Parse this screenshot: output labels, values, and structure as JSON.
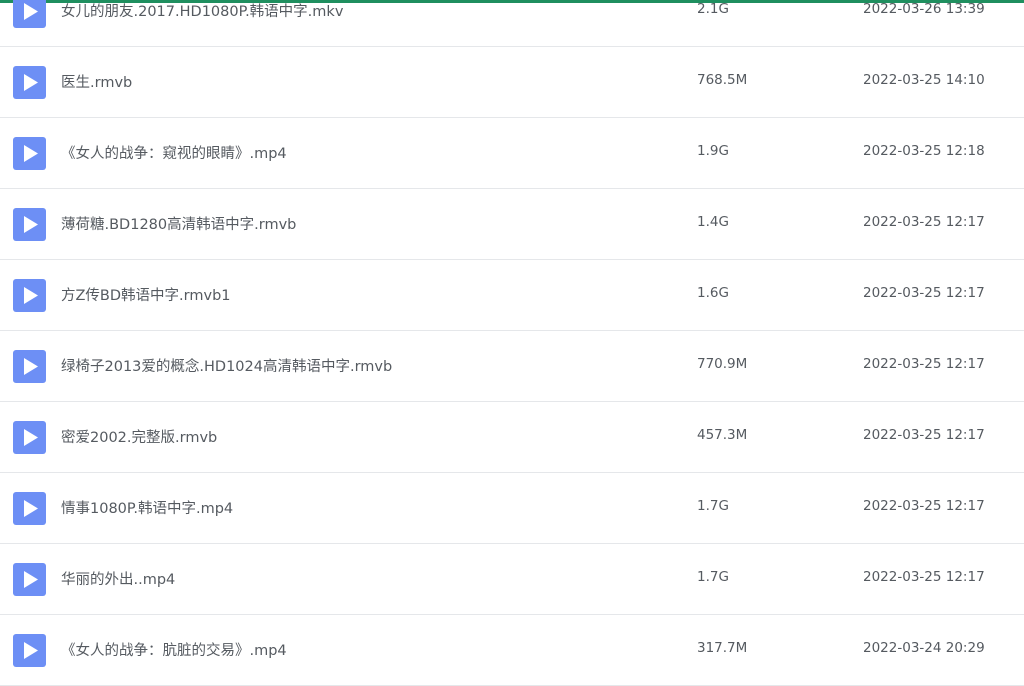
{
  "colors": {
    "accent": "#1f8f5f",
    "play_icon_bg": "#6d8ff5",
    "text": "#555a60",
    "divider": "#e5e7ea"
  },
  "files": [
    {
      "icon": "video-play-icon",
      "name": "女儿的朋友.2017.HD1080P.韩语中字.mkv",
      "size": "2.1G",
      "date": "2022-03-26 13:39"
    },
    {
      "icon": "video-play-icon",
      "name": "医生.rmvb",
      "size": "768.5M",
      "date": "2022-03-25 14:10"
    },
    {
      "icon": "video-play-icon",
      "name": "《女人的战争：窥视的眼睛》.mp4",
      "size": "1.9G",
      "date": "2022-03-25 12:18"
    },
    {
      "icon": "video-play-icon",
      "name": "薄荷糖.BD1280高清韩语中字.rmvb",
      "size": "1.4G",
      "date": "2022-03-25 12:17"
    },
    {
      "icon": "video-play-icon",
      "name": "方Z传BD韩语中字.rmvb1",
      "size": "1.6G",
      "date": "2022-03-25 12:17"
    },
    {
      "icon": "video-play-icon",
      "name": "绿椅子2013爱的概念.HD1024高清韩语中字.rmvb",
      "size": "770.9M",
      "date": "2022-03-25 12:17"
    },
    {
      "icon": "video-play-icon",
      "name": "密爱2002.完整版.rmvb",
      "size": "457.3M",
      "date": "2022-03-25 12:17"
    },
    {
      "icon": "video-play-icon",
      "name": "情事1080P.韩语中字.mp4",
      "size": "1.7G",
      "date": "2022-03-25 12:17"
    },
    {
      "icon": "video-play-icon",
      "name": "华丽的外出..mp4",
      "size": "1.7G",
      "date": "2022-03-25 12:17"
    },
    {
      "icon": "video-play-icon",
      "name": "《女人的战争：肮脏的交易》.mp4",
      "size": "317.7M",
      "date": "2022-03-24 20:29"
    }
  ]
}
